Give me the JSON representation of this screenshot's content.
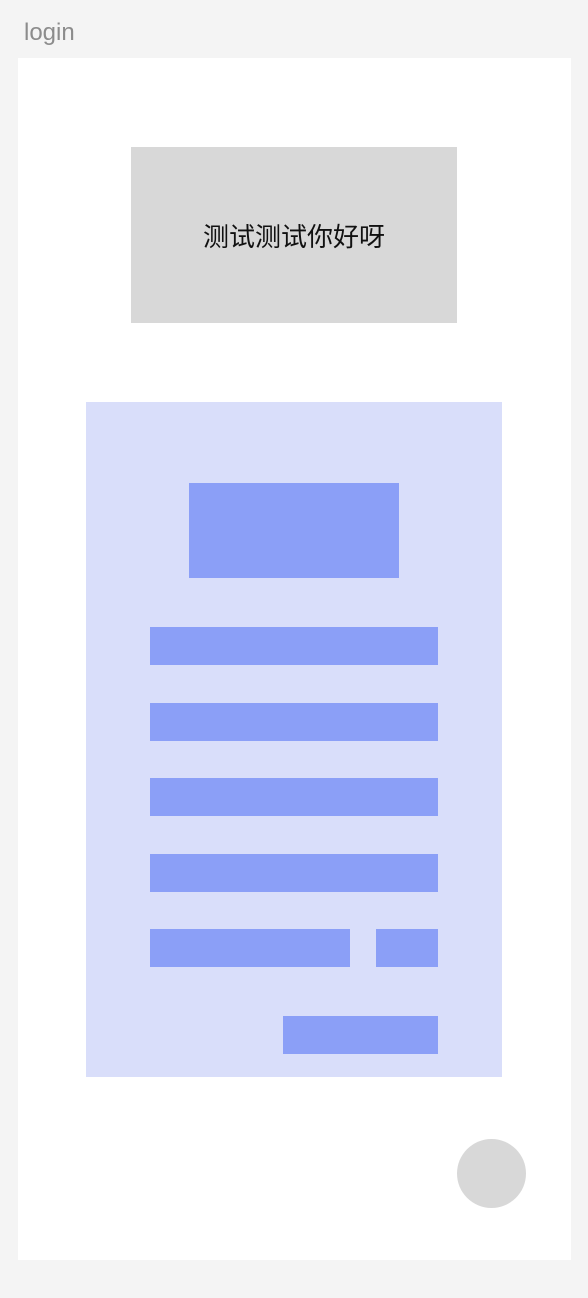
{
  "page": {
    "label": "login"
  },
  "banner": {
    "text": "测试测试你好呀"
  },
  "colors": {
    "background": "#f4f4f4",
    "artboard": "#ffffff",
    "banner": "#d8d8d8",
    "panel": "#d9defa",
    "placeholder_block": "#8b9ff7",
    "fab": "#d8d8d8"
  }
}
